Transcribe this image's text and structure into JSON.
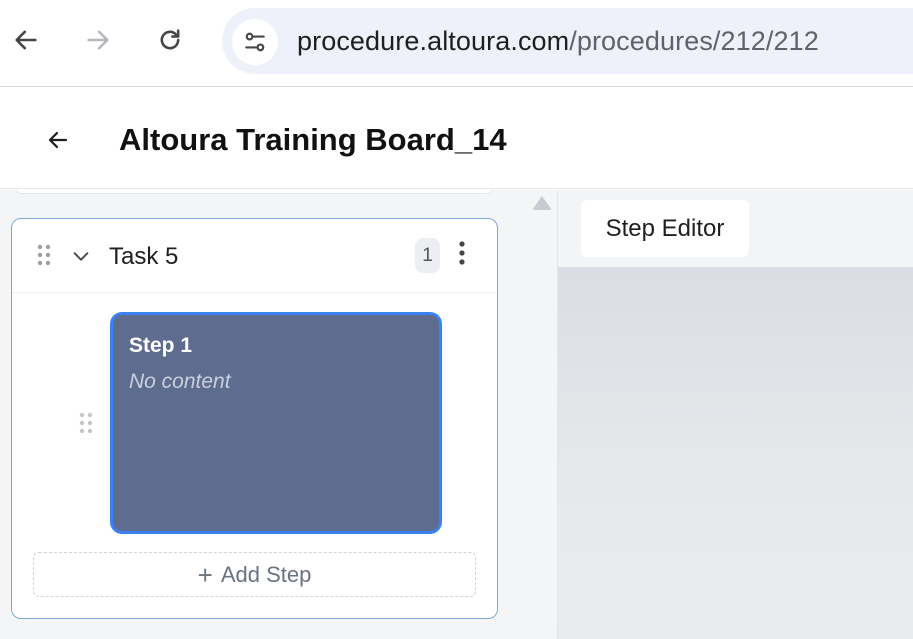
{
  "browser": {
    "url_domain": "procedure.altoura.com",
    "url_path": "/procedures/212/212"
  },
  "header": {
    "title": "Altoura Training Board_14"
  },
  "task": {
    "title": "Task 5",
    "count": "1",
    "steps": [
      {
        "title": "Step 1",
        "subtitle": "No content"
      }
    ],
    "add_step_label": "Add Step"
  },
  "editor": {
    "tab_label": "Step Editor"
  },
  "colors": {
    "step_card_bg": "#5e6d8f",
    "step_card_border": "#3b82f6",
    "task_card_border": "#7ea7e0"
  }
}
